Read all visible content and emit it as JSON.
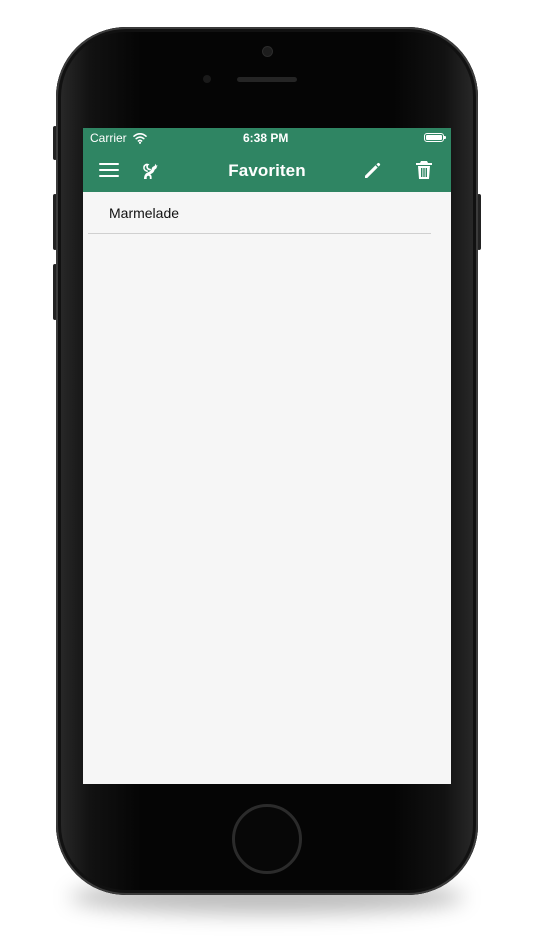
{
  "status_bar": {
    "carrier": "Carrier",
    "time": "6:38 PM"
  },
  "header": {
    "title": "Favoriten",
    "menu_icon": "menu-icon",
    "logo_icon": "cat-logo-icon",
    "edit_icon": "pencil-icon",
    "delete_icon": "trash-icon"
  },
  "favorites": {
    "items": [
      {
        "label": "Marmelade"
      }
    ]
  },
  "colors": {
    "header_background": "#2f8563",
    "screen_background": "#f6f6f6",
    "divider": "#d0d0d0"
  }
}
